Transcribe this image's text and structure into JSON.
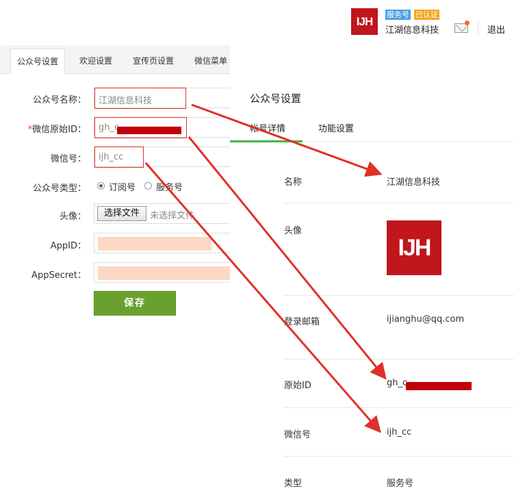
{
  "header": {
    "logo_text": "IJH",
    "badge_service": "服务号",
    "badge_verified": "已认证",
    "account_name": "江湖信息科技",
    "logout": "退出"
  },
  "left": {
    "tabs": [
      "公众号设置",
      "欢迎设置",
      "宣传页设置",
      "微信菜单"
    ],
    "fields": {
      "name_label": "公众号名称：",
      "name_value": "江湖信息科技",
      "origid_req": "*",
      "origid_label": "微信原始ID：",
      "origid_value": "gh_c",
      "wechat_label": "微信号：",
      "wechat_value": "ijh_cc",
      "type_label": "公众号类型：",
      "type_opt1": "订阅号",
      "type_opt2": "服务号",
      "avatar_label": "头像：",
      "file_button": "选择文件",
      "file_none": "未选择文件",
      "appid_label": "AppID：",
      "appsecret_label": "AppSecret："
    },
    "save_button": "保存"
  },
  "right": {
    "title": "公众号设置",
    "tabs": [
      "帐号详情",
      "功能设置"
    ],
    "rows": {
      "name_label": "名称",
      "name_value": "江湖信息科技",
      "avatar_label": "头像",
      "avatar_text": "IJH",
      "email_label": "登录邮箱",
      "email_value": "ijianghu@qq.com",
      "origid_label": "原始ID",
      "origid_value": "gh_c",
      "wechat_label": "微信号",
      "wechat_value": "ijh_cc",
      "type_label": "类型",
      "type_value": "服务号"
    }
  },
  "colors": {
    "brand_red": "#c0161c",
    "annotation_red": "#e0302a",
    "save_green": "#6aa12e",
    "tab_green": "#44b549"
  }
}
